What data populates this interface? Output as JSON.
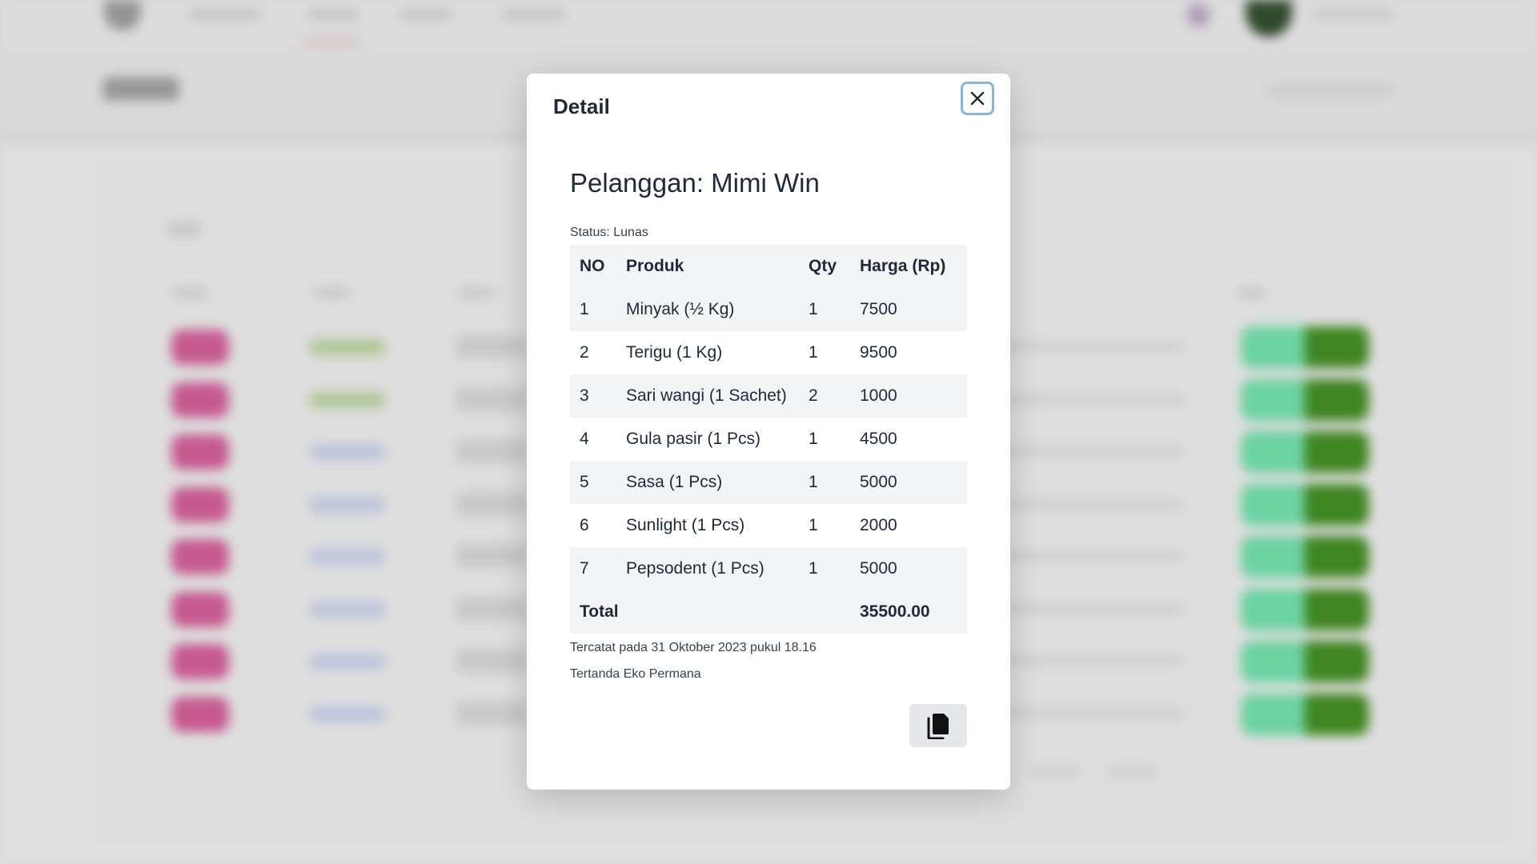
{
  "modal": {
    "title": "Detail",
    "close_icon": "close-icon",
    "customer_heading": "Pelanggan: Mimi Win",
    "status_text": "Status: Lunas",
    "table": {
      "headers": [
        "NO",
        "Produk",
        "Qty",
        "Harga (Rp)"
      ],
      "rows": [
        {
          "no": "1",
          "product": "Minyak (½ Kg)",
          "qty": "1",
          "price": "7500"
        },
        {
          "no": "2",
          "product": "Terigu (1 Kg)",
          "qty": "1",
          "price": "9500"
        },
        {
          "no": "3",
          "product": "Sari wangi (1 Sachet)",
          "qty": "2",
          "price": "1000"
        },
        {
          "no": "4",
          "product": "Gula pasir (1 Pcs)",
          "qty": "1",
          "price": "4500"
        },
        {
          "no": "5",
          "product": "Sasa (1 Pcs)",
          "qty": "1",
          "price": "5000"
        },
        {
          "no": "6",
          "product": "Sunlight (1 Pcs)",
          "qty": "1",
          "price": "2000"
        },
        {
          "no": "7",
          "product": "Pepsodent (1 Pcs)",
          "qty": "1",
          "price": "5000"
        }
      ],
      "total_label": "Total",
      "total_value": "35500.00"
    },
    "recorded_text": "Tercatat pada 31 Oktober 2023 pukul 18.16",
    "signed_text": "Tertanda Eko Permana",
    "copy_icon": "copy-icon"
  },
  "colors": {
    "close_focus_ring": "#8ab4db",
    "striped_row": "#f3f4f6",
    "copy_button_bg": "#e5e7eb"
  }
}
